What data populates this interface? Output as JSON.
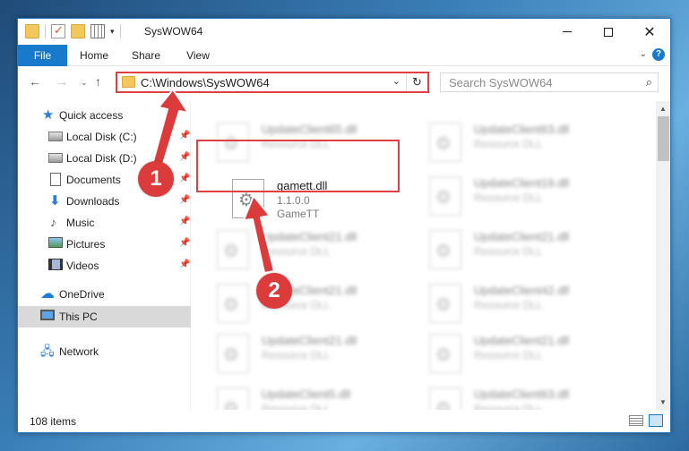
{
  "window": {
    "title": "SysWOW64",
    "qa_dropdown": "▾",
    "minimize_glyph": "",
    "close_glyph": "✕"
  },
  "ribbon": {
    "tabs": [
      "File",
      "Home",
      "Share",
      "View"
    ],
    "collapse_glyph": "⌄",
    "help_glyph": "?"
  },
  "nav": {
    "back_glyph": "←",
    "forward_glyph": "→",
    "recent_glyph": "⌄",
    "up_glyph": "↑",
    "address": "C:\\Windows\\SysWOW64",
    "address_dropdown": "⌄",
    "refresh_glyph": "↻",
    "search_placeholder": "Search SysWOW64",
    "search_glyph": "⌕"
  },
  "sidebar": {
    "pin_glyph": "📌",
    "items": [
      {
        "label": "Quick access",
        "icon": "star-icon"
      },
      {
        "label": "Local Disk (C:)",
        "icon": "drive-icon"
      },
      {
        "label": "Local Disk (D:)",
        "icon": "drive-icon"
      },
      {
        "label": "Documents",
        "icon": "documents-icon"
      },
      {
        "label": "Downloads",
        "icon": "download-icon"
      },
      {
        "label": "Music",
        "icon": "music-icon"
      },
      {
        "label": "Pictures",
        "icon": "pictures-icon"
      },
      {
        "label": "Videos",
        "icon": "videos-icon"
      },
      {
        "label": "OneDrive",
        "icon": "cloud-icon"
      },
      {
        "label": "This PC",
        "icon": "computer-icon"
      },
      {
        "label": "Network",
        "icon": "network-icon"
      }
    ],
    "selected": "This PC"
  },
  "files": [
    {
      "name": "UpdateClient65.dll",
      "line2": "Resource DLL",
      "line3": "",
      "blurred": true
    },
    {
      "name": "UpdateClient63.dll",
      "line2": "Resource DLL",
      "line3": "",
      "blurred": true
    },
    {
      "name": "gamett.dll",
      "line2": "1.1.0.0",
      "line3": "GameTT",
      "blurred": false
    },
    {
      "name": "UpdateClient19.dll",
      "line2": "Resource DLL",
      "line3": "",
      "blurred": true
    },
    {
      "name": "UpdateClient21.dll",
      "line2": "Resource DLL",
      "line3": "",
      "blurred": true
    },
    {
      "name": "UpdateClient21.dll",
      "line2": "Resource DLL",
      "line3": "",
      "blurred": true
    },
    {
      "name": "UpdateClient21.dll",
      "line2": "Resource DLL",
      "line3": "",
      "blurred": true
    },
    {
      "name": "UpdateClient42.dll",
      "line2": "Resource DLL",
      "line3": "",
      "blurred": true
    },
    {
      "name": "UpdateClient21.dll",
      "line2": "Resource DLL",
      "line3": "",
      "blurred": true
    },
    {
      "name": "UpdateClient21.dll",
      "line2": "Resource DLL",
      "line3": "",
      "blurred": true
    },
    {
      "name": "UpdateClient5.dll",
      "line2": "Resource DLL",
      "line3": "",
      "blurred": true
    },
    {
      "name": "UpdateClient63.dll",
      "line2": "Resource DLL",
      "line3": "",
      "blurred": true
    }
  ],
  "scrollbar": {
    "up_glyph": "▲",
    "down_glyph": "▼"
  },
  "status": {
    "item_count": "108 items"
  },
  "annotations": {
    "badge_1": "1",
    "badge_2": "2",
    "color": "#dc3b3b"
  },
  "colors": {
    "accent": "#1979ca",
    "highlight_border": "#e04040"
  }
}
